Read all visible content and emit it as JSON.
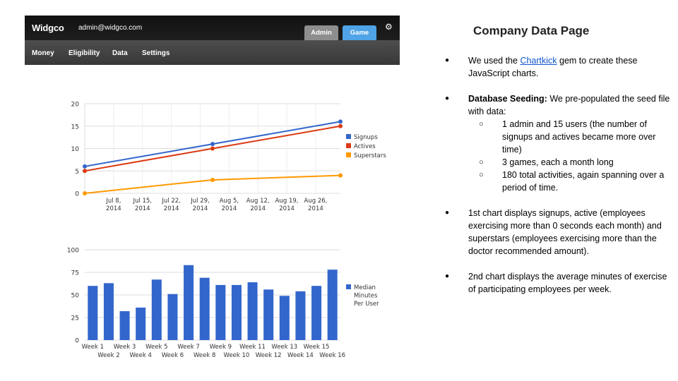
{
  "header": {
    "brand": "Widgco",
    "user_email": "admin@widgco.com",
    "tabs": [
      "Admin",
      "Game"
    ],
    "nav": [
      "Money",
      "Eligibility",
      "Data",
      "Settings"
    ],
    "colors": {
      "tab_admin": "#8e8e8e",
      "tab_game": "#4fa3e6"
    }
  },
  "notes": {
    "title": "Company Data Page",
    "p1_before": "We used the ",
    "p1_link": "Chartkick",
    "p1_after": " gem to create these JavaScript charts.",
    "p2_bold": "Database Seeding:",
    "p2_text": " We pre-populated the seed file with data:",
    "sub": [
      "1 admin and 15 users (the number of signups and actives became more over time)",
      "3 games, each a month long",
      "180 total activities, again spanning over a period of time."
    ],
    "p3": "1st chart displays signups,  active (employees exercising more than 0 seconds each month) and superstars (employees exercising more than the doctor recommended amount).",
    "p4": "2nd chart displays the average minutes of exercise of participating employees per week."
  },
  "chart_data": [
    {
      "type": "line",
      "x_ticks": [
        "Jul 8, 2014",
        "Jul 15, 2014",
        "Jul 22, 2014",
        "Jul 29, 2014",
        "Aug 5, 2014",
        "Aug 12, 2014",
        "Aug 19, 2014",
        "Aug 26, 2014"
      ],
      "x_range": [
        "2014-07-01",
        "2014-09-01"
      ],
      "ylim": [
        0,
        20
      ],
      "y_ticks": [
        0,
        5,
        10,
        15,
        20
      ],
      "grid": true,
      "legend": "right",
      "series": [
        {
          "name": "Signups",
          "color": "#3366cc",
          "x": [
            "2014-07-01",
            "2014-08-01",
            "2014-09-01"
          ],
          "values": [
            6,
            11,
            16
          ]
        },
        {
          "name": "Actives",
          "color": "#dc3912",
          "x": [
            "2014-07-01",
            "2014-08-01",
            "2014-09-01"
          ],
          "values": [
            5,
            10,
            15
          ]
        },
        {
          "name": "Superstars",
          "color": "#ff9900",
          "x": [
            "2014-07-01",
            "2014-08-01",
            "2014-09-01"
          ],
          "values": [
            0,
            3,
            4
          ]
        }
      ]
    },
    {
      "type": "bar",
      "categories": [
        "Week 1",
        "Week 2",
        "Week 3",
        "Week 4",
        "Week 5",
        "Week 6",
        "Week 7",
        "Week 8",
        "Week 9",
        "Week 10",
        "Week 11",
        "Week 12",
        "Week 13",
        "Week 14",
        "Week 15",
        "Week 16"
      ],
      "ylim": [
        0,
        100
      ],
      "y_ticks": [
        0,
        25,
        50,
        75,
        100
      ],
      "grid": true,
      "legend": "right",
      "series": [
        {
          "name": "Median Minutes Per User",
          "color": "#3366cc",
          "values": [
            60,
            63,
            32,
            36,
            67,
            51,
            83,
            69,
            61,
            61,
            64,
            56,
            49,
            54,
            60,
            78
          ]
        }
      ]
    }
  ]
}
